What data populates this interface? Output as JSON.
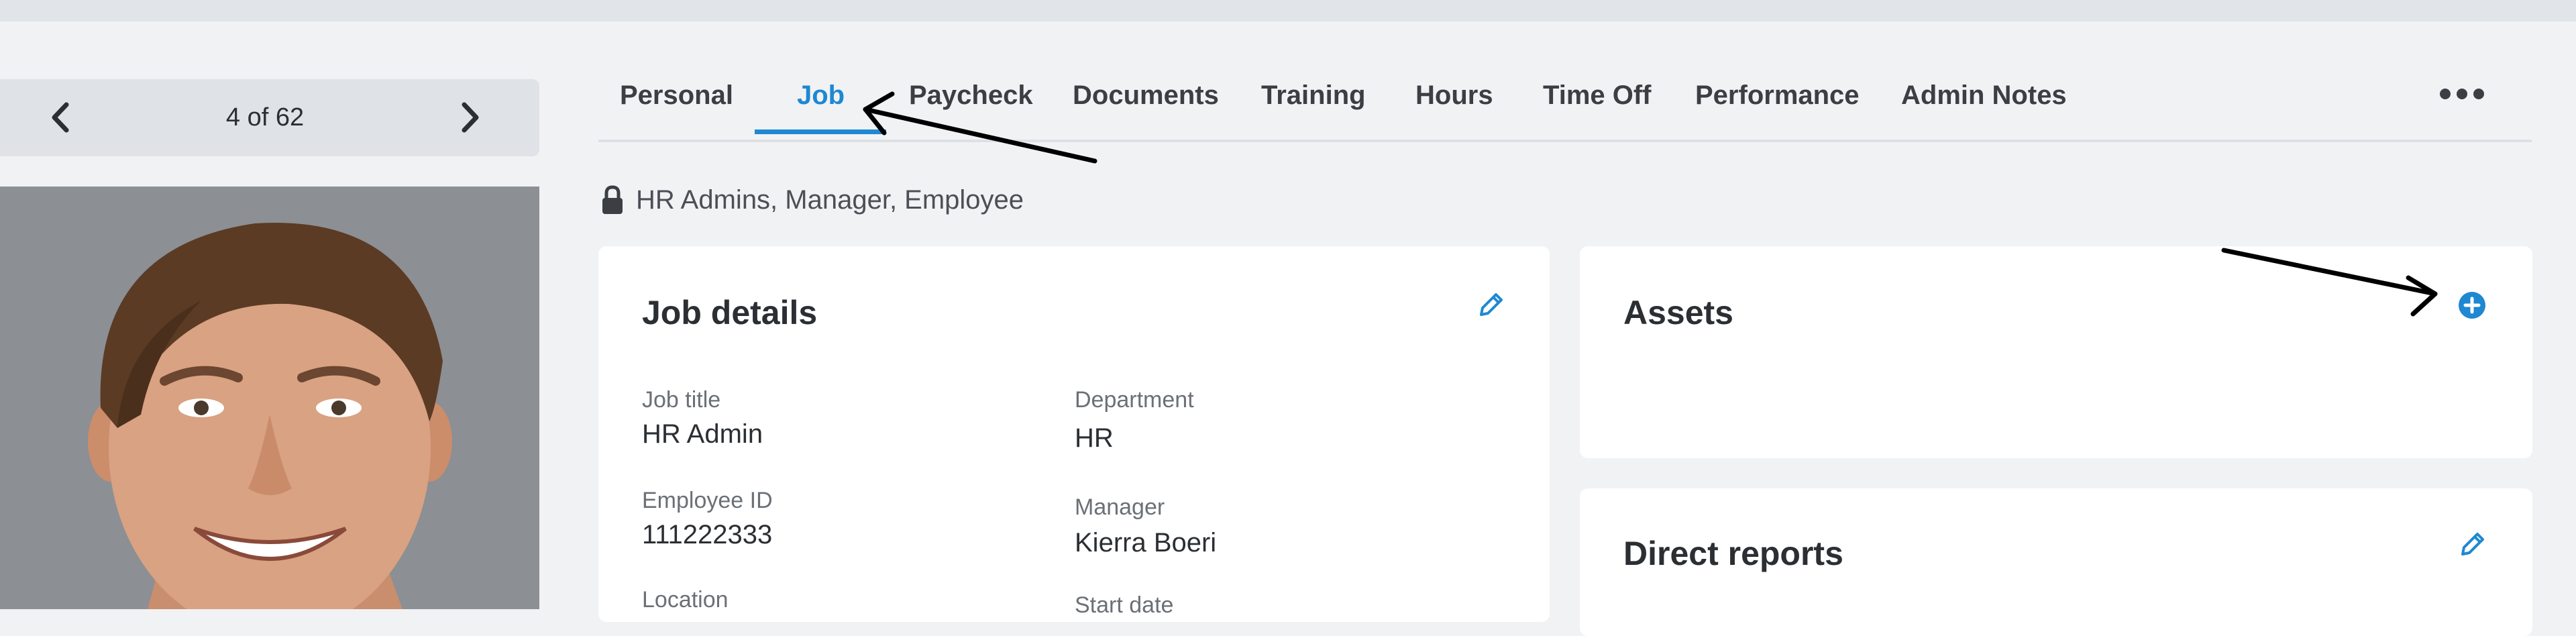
{
  "pager": {
    "count": "4 of 62"
  },
  "tabs": [
    {
      "label": "Personal"
    },
    {
      "label": "Job"
    },
    {
      "label": "Paycheck"
    },
    {
      "label": "Documents"
    },
    {
      "label": "Training"
    },
    {
      "label": "Hours"
    },
    {
      "label": "Time Off"
    },
    {
      "label": "Performance"
    },
    {
      "label": "Admin Notes"
    }
  ],
  "active_tab": "Job",
  "permissions": {
    "text": "HR Admins, Manager, Employee"
  },
  "job_details": {
    "title": "Job details",
    "fields": [
      {
        "label": "Job title",
        "value": "HR Admin"
      },
      {
        "label": "Department",
        "value": "HR"
      },
      {
        "label": "Employee ID",
        "value": "111222333"
      },
      {
        "label": "Manager",
        "value": "Kierra Boeri"
      },
      {
        "label": "Location",
        "value": ""
      },
      {
        "label": "Start date",
        "value": ""
      }
    ]
  },
  "assets": {
    "title": "Assets"
  },
  "direct_reports": {
    "title": "Direct reports"
  },
  "colors": {
    "accent": "#1e88d2",
    "background": "#f1f2f4",
    "card": "#ffffff"
  },
  "icons": {
    "prev": "chevron-left-icon",
    "next": "chevron-right-icon",
    "more": "more-horizontal-icon",
    "lock": "lock-icon",
    "edit": "pencil-icon",
    "add": "plus-circle-icon"
  }
}
